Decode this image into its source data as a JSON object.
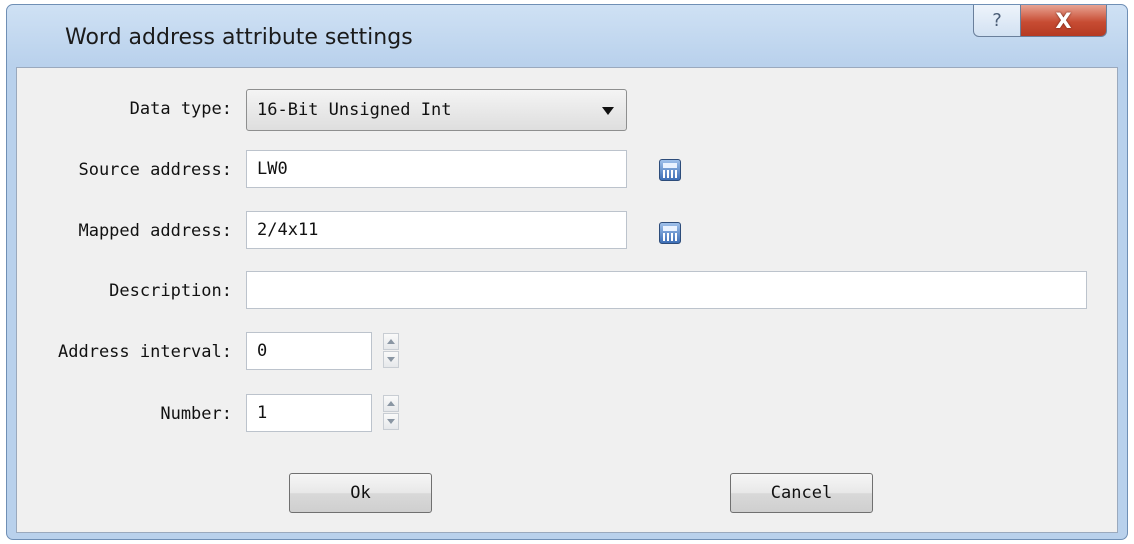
{
  "window": {
    "title": "Word address attribute settings",
    "help_glyph": "?",
    "close_glyph": "X"
  },
  "form": {
    "data_type": {
      "label": "Data type:",
      "value": "16-Bit Unsigned Int"
    },
    "source_address": {
      "label": "Source address:",
      "value": "LW0"
    },
    "mapped_address": {
      "label": "Mapped address:",
      "value": "2/4x11"
    },
    "description": {
      "label": "Description:",
      "value": ""
    },
    "address_interval": {
      "label": "Address interval:",
      "value": "0"
    },
    "number": {
      "label": "Number:",
      "value": "1"
    }
  },
  "buttons": {
    "ok": "Ok",
    "cancel": "Cancel"
  },
  "icons": {
    "source_address_picker": "calculator-icon",
    "mapped_address_picker": "calculator-icon"
  }
}
